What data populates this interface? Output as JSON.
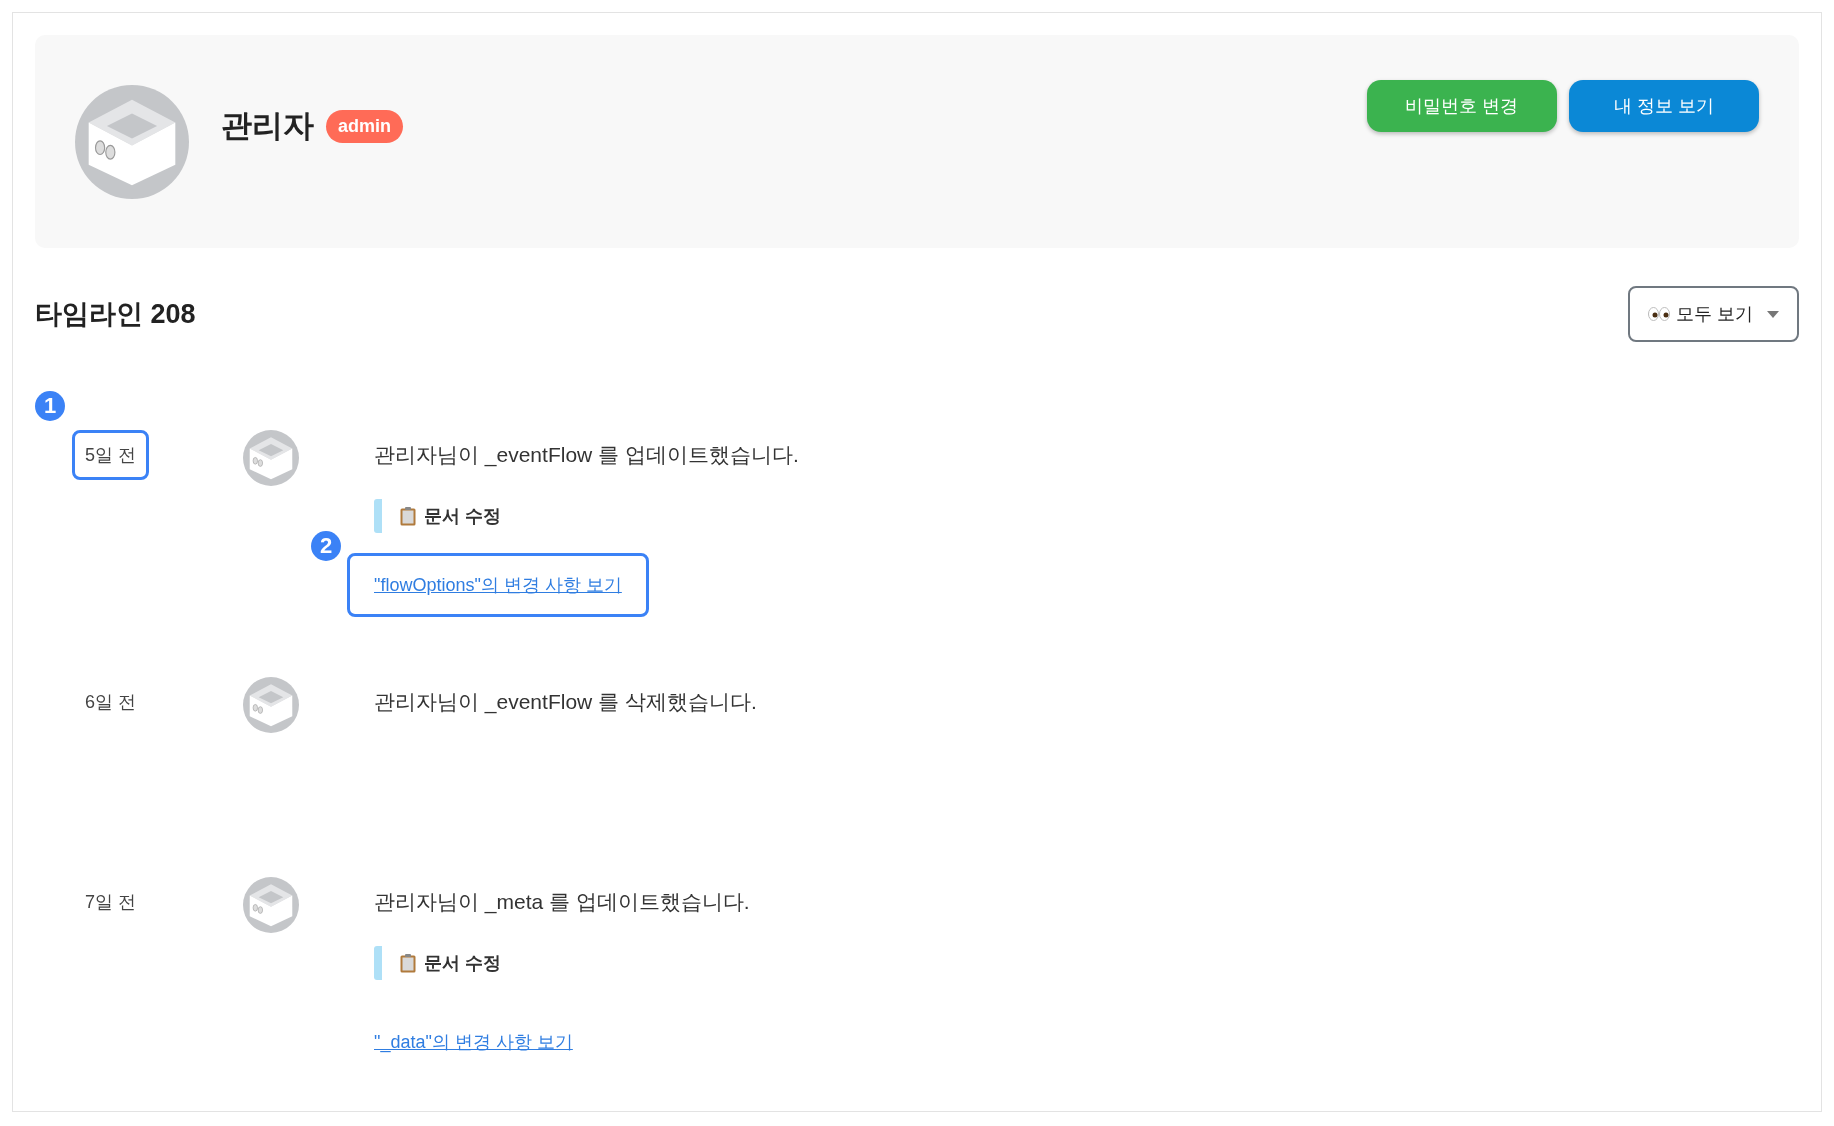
{
  "profile": {
    "name": "관리자",
    "role_badge": "admin",
    "buttons": [
      {
        "label": "비밀번호 변경",
        "kind": "green"
      },
      {
        "label": "내 정보 보기",
        "kind": "blue"
      }
    ]
  },
  "timeline": {
    "title": "타임라인 208",
    "filter": {
      "label": "모두 보기"
    },
    "items": [
      {
        "time": "5일 전",
        "time_callout": "1",
        "message": "관리자님이 _eventFlow 를 업데이트했습니다.",
        "note": "문서 수정",
        "link": "\"flowOptions\"의 변경 사항 보기",
        "link_callout": "2"
      },
      {
        "time": "6일 전",
        "message": "관리자님이 _eventFlow 를 삭제했습니다."
      },
      {
        "time": "7일 전",
        "message": "관리자님이 _meta 를 업데이트했습니다.",
        "note": "문서 수정",
        "link": "\"_data\"의 변경 사항 보기"
      }
    ]
  }
}
